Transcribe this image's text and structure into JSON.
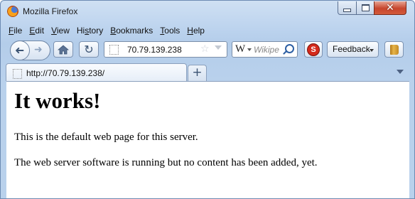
{
  "window": {
    "title": "Mozilla Firefox"
  },
  "menu": [
    {
      "key": "F",
      "rest": "ile"
    },
    {
      "key": "E",
      "rest": "dit"
    },
    {
      "key": "V",
      "rest": "iew"
    },
    {
      "key": "",
      "pre": "Hi",
      "keymid": "s",
      "rest": "tory"
    },
    {
      "key": "B",
      "rest": "ookmarks"
    },
    {
      "key": "T",
      "rest": "ools"
    },
    {
      "key": "H",
      "rest": "elp"
    }
  ],
  "toolbar": {
    "url": "70.79.139.238",
    "search_engine_icon": "W",
    "search_placeholder": "Wikipe",
    "feedback_label": "Feedback"
  },
  "tab": {
    "title": "http://70.79.139.238/",
    "new_tab_symbol": "+"
  },
  "page": {
    "heading": "It works!",
    "paragraph1": "This is the default web page for this server.",
    "paragraph2": "The web server software is running but no content has been added, yet."
  },
  "icons": {
    "close": "✕",
    "back": "➜",
    "forward": "➜",
    "reload": "↻",
    "star": "☆",
    "addon": "S"
  }
}
